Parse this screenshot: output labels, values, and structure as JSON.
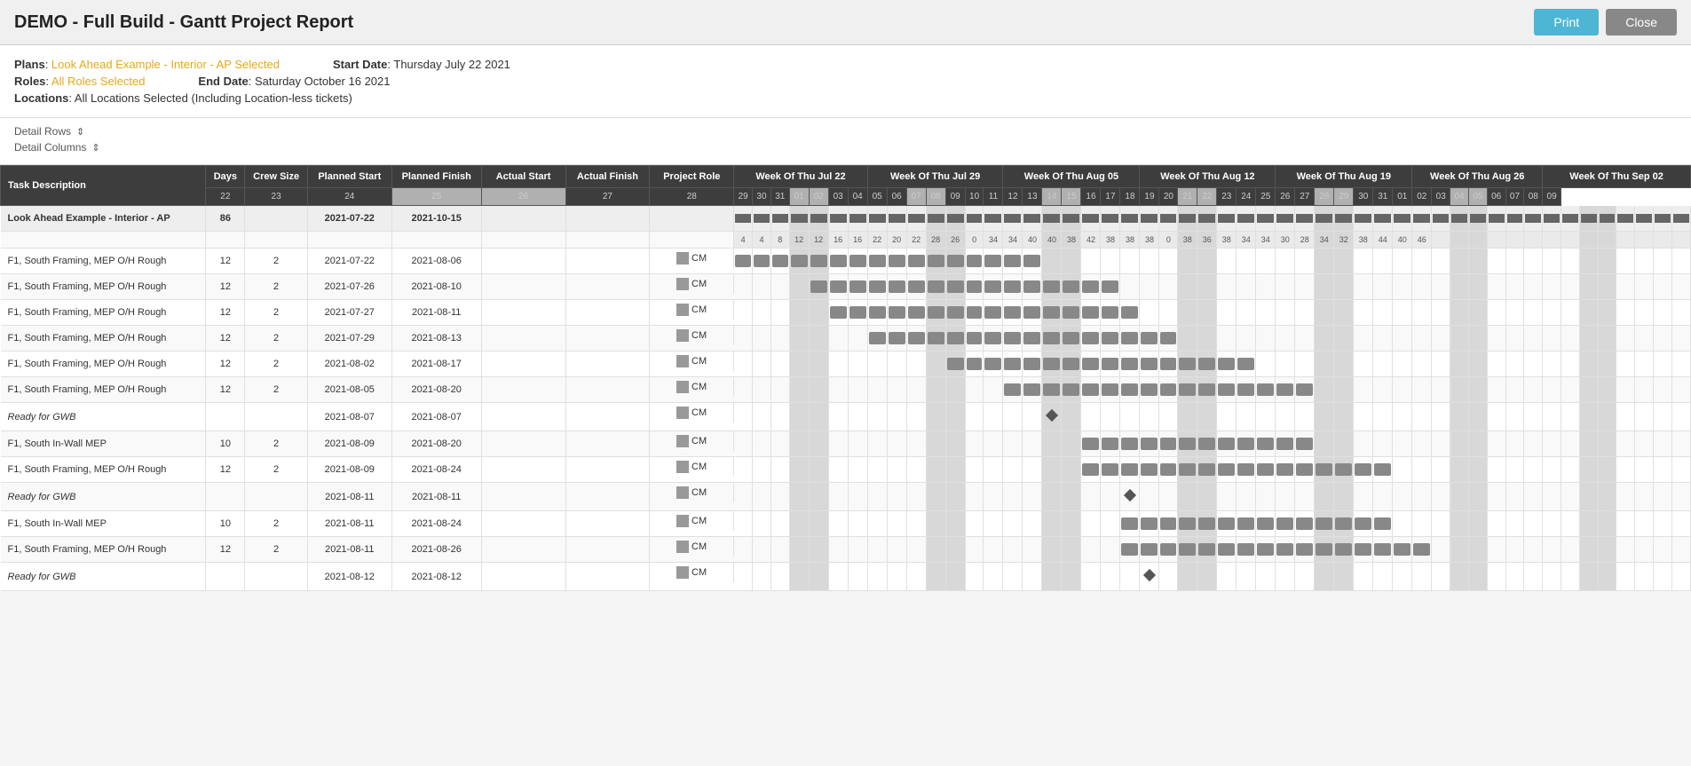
{
  "header": {
    "title": "DEMO - Full Build - Gantt Project Report",
    "print_label": "Print",
    "close_label": "Close"
  },
  "meta": {
    "plans_label": "Plans",
    "plans_value": "Look Ahead Example - Interior - AP Selected",
    "roles_label": "Roles",
    "roles_value": "All Roles Selected",
    "locations_label": "Locations",
    "locations_value": "All Locations Selected (Including Location-less tickets)",
    "start_date_label": "Start Date",
    "start_date_value": "Thursday July 22 2021",
    "end_date_label": "End Date",
    "end_date_value": "Saturday October 16 2021"
  },
  "controls": {
    "detail_rows_label": "Detail Rows",
    "detail_columns_label": "Detail Columns"
  },
  "table": {
    "columns": [
      "Task Description",
      "Days",
      "Crew Size",
      "Planned Start",
      "Planned Finish",
      "Actual Start",
      "Actual Finish",
      "Project Role"
    ],
    "weeks": [
      "Week Of Thu Jul 22",
      "Week Of Thu Jul 29",
      "Week Of Thu Aug 05",
      "Week Of Thu Aug 12",
      "Week Of Thu Aug 19",
      "Week Of Thu Aug 26",
      "Week Of Thu Sep 02"
    ],
    "rows": [
      {
        "task": "Look Ahead Example - Interior - AP",
        "days": "86",
        "crew": "",
        "planned_start": "2021-07-22",
        "planned_finish": "2021-10-15",
        "actual_start": "",
        "actual_finish": "",
        "role": "",
        "type": "summary",
        "sub_numbers": "4  4        8  12  12  16  16        22  20  22  28  26  0        34  34  40  40  38        42  38  38  38  0        38  36  38  34        34  30  28  34  32        38  44  40  46"
      },
      {
        "task": "F1, South Framing, MEP O/H Rough",
        "days": "12",
        "crew": "2",
        "planned_start": "2021-07-22",
        "planned_finish": "2021-08-06",
        "actual_start": "",
        "actual_finish": "",
        "role": "CM",
        "type": "normal"
      },
      {
        "task": "F1, South Framing, MEP O/H Rough",
        "days": "12",
        "crew": "2",
        "planned_start": "2021-07-26",
        "planned_finish": "2021-08-10",
        "actual_start": "",
        "actual_finish": "",
        "role": "CM",
        "type": "normal"
      },
      {
        "task": "F1, South Framing, MEP O/H Rough",
        "days": "12",
        "crew": "2",
        "planned_start": "2021-07-27",
        "planned_finish": "2021-08-11",
        "actual_start": "",
        "actual_finish": "",
        "role": "CM",
        "type": "normal"
      },
      {
        "task": "F1, South Framing, MEP O/H Rough",
        "days": "12",
        "crew": "2",
        "planned_start": "2021-07-29",
        "planned_finish": "2021-08-13",
        "actual_start": "",
        "actual_finish": "",
        "role": "CM",
        "type": "normal"
      },
      {
        "task": "F1, South Framing, MEP O/H Rough",
        "days": "12",
        "crew": "2",
        "planned_start": "2021-08-02",
        "planned_finish": "2021-08-17",
        "actual_start": "",
        "actual_finish": "",
        "role": "CM",
        "type": "normal"
      },
      {
        "task": "F1, South Framing, MEP O/H Rough",
        "days": "12",
        "crew": "2",
        "planned_start": "2021-08-05",
        "planned_finish": "2021-08-20",
        "actual_start": "",
        "actual_finish": "",
        "role": "CM",
        "type": "normal"
      },
      {
        "task": "Ready for GWB",
        "days": "",
        "crew": "",
        "planned_start": "2021-08-07",
        "planned_finish": "2021-08-07",
        "actual_start": "",
        "actual_finish": "",
        "role": "CM",
        "type": "milestone"
      },
      {
        "task": "F1, South In-Wall MEP",
        "days": "10",
        "crew": "2",
        "planned_start": "2021-08-09",
        "planned_finish": "2021-08-20",
        "actual_start": "",
        "actual_finish": "",
        "role": "CM",
        "type": "normal"
      },
      {
        "task": "F1, South Framing, MEP O/H Rough",
        "days": "12",
        "crew": "2",
        "planned_start": "2021-08-09",
        "planned_finish": "2021-08-24",
        "actual_start": "",
        "actual_finish": "",
        "role": "CM",
        "type": "normal"
      },
      {
        "task": "Ready for GWB",
        "days": "",
        "crew": "",
        "planned_start": "2021-08-11",
        "planned_finish": "2021-08-11",
        "actual_start": "",
        "actual_finish": "",
        "role": "CM",
        "type": "milestone"
      },
      {
        "task": "F1, South In-Wall MEP",
        "days": "10",
        "crew": "2",
        "planned_start": "2021-08-11",
        "planned_finish": "2021-08-24",
        "actual_start": "",
        "actual_finish": "",
        "role": "CM",
        "type": "normal"
      },
      {
        "task": "F1, South Framing, MEP O/H Rough",
        "days": "12",
        "crew": "2",
        "planned_start": "2021-08-11",
        "planned_finish": "2021-08-26",
        "actual_start": "",
        "actual_finish": "",
        "role": "CM",
        "type": "normal"
      },
      {
        "task": "Ready for GWB",
        "days": "",
        "crew": "",
        "planned_start": "2021-08-12",
        "planned_finish": "2021-08-12",
        "actual_start": "",
        "actual_finish": "",
        "role": "CM",
        "type": "milestone"
      }
    ],
    "date_columns": [
      {
        "date": "22",
        "weekend": false
      },
      {
        "date": "23",
        "weekend": false
      },
      {
        "date": "24",
        "weekend": false
      },
      {
        "date": "25",
        "weekend": true
      },
      {
        "date": "26",
        "weekend": true
      },
      {
        "date": "27",
        "weekend": false
      },
      {
        "date": "28",
        "weekend": false
      },
      {
        "date": "29",
        "weekend": false
      },
      {
        "date": "30",
        "weekend": false
      },
      {
        "date": "31",
        "weekend": false
      },
      {
        "date": "01",
        "weekend": true
      },
      {
        "date": "02",
        "weekend": true
      },
      {
        "date": "03",
        "weekend": false
      },
      {
        "date": "04",
        "weekend": false
      },
      {
        "date": "05",
        "weekend": false
      },
      {
        "date": "06",
        "weekend": false
      },
      {
        "date": "07",
        "weekend": true
      },
      {
        "date": "08",
        "weekend": true
      },
      {
        "date": "09",
        "weekend": false
      },
      {
        "date": "10",
        "weekend": false
      },
      {
        "date": "11",
        "weekend": false
      },
      {
        "date": "12",
        "weekend": false
      },
      {
        "date": "13",
        "weekend": false
      },
      {
        "date": "14",
        "weekend": true
      },
      {
        "date": "15",
        "weekend": true
      },
      {
        "date": "16",
        "weekend": false
      },
      {
        "date": "17",
        "weekend": false
      },
      {
        "date": "18",
        "weekend": false
      },
      {
        "date": "19",
        "weekend": false
      },
      {
        "date": "20",
        "weekend": false
      },
      {
        "date": "21",
        "weekend": true
      },
      {
        "date": "22",
        "weekend": true
      },
      {
        "date": "23",
        "weekend": false
      },
      {
        "date": "24",
        "weekend": false
      },
      {
        "date": "25",
        "weekend": false
      },
      {
        "date": "26",
        "weekend": false
      },
      {
        "date": "27",
        "weekend": false
      },
      {
        "date": "28",
        "weekend": true
      },
      {
        "date": "29",
        "weekend": true
      },
      {
        "date": "30",
        "weekend": false
      },
      {
        "date": "31",
        "weekend": false
      },
      {
        "date": "01",
        "weekend": false
      },
      {
        "date": "02",
        "weekend": false
      },
      {
        "date": "03",
        "weekend": false
      },
      {
        "date": "04",
        "weekend": true
      },
      {
        "date": "05",
        "weekend": true
      },
      {
        "date": "06",
        "weekend": false
      },
      {
        "date": "07",
        "weekend": false
      },
      {
        "date": "08",
        "weekend": false
      },
      {
        "date": "09",
        "weekend": false
      }
    ]
  }
}
